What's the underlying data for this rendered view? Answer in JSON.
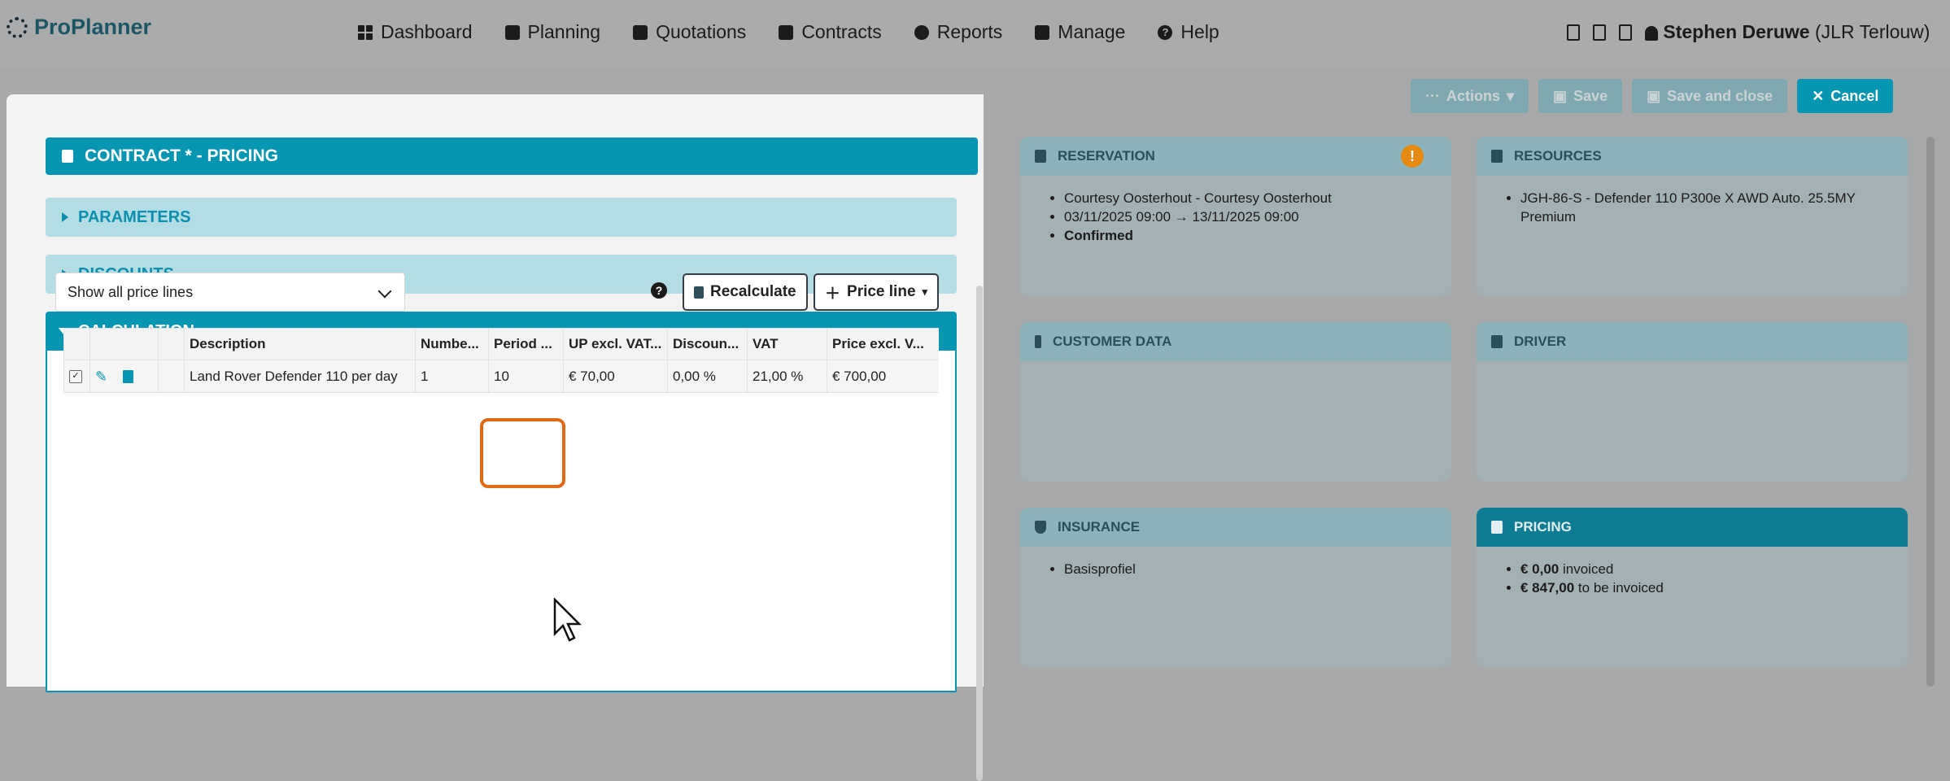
{
  "app": {
    "logo": "ProPlanner"
  },
  "nav": [
    "Dashboard",
    "Planning",
    "Quotations",
    "Contracts",
    "Reports",
    "Manage",
    "Help"
  ],
  "user": {
    "name": "Stephen Deruwe",
    "org": "(JLR Terlouw)"
  },
  "actions": {
    "actions": "Actions",
    "save": "Save",
    "save_close": "Save and close",
    "cancel": "Cancel"
  },
  "modal": {
    "title": "CONTRACT * - PRICING",
    "parameters": "PARAMETERS",
    "discounts": "DISCOUNTS",
    "calculation": "CALCULATION",
    "filter": "Show all price lines",
    "recalculate": "Recalculate",
    "price_line": "Price line",
    "columns": [
      "Description",
      "Numbe...",
      "Period ...",
      "UP excl. VAT...",
      "Discoun...",
      "VAT",
      "Price excl. V..."
    ],
    "rows": [
      {
        "description": "Land Rover Defender 110 per day",
        "number": "1",
        "period": "10",
        "up_excl": "€ 70,00",
        "discount": "0,00 %",
        "vat": "21,00 %",
        "price_excl": "€ 700,00"
      }
    ]
  },
  "cards": {
    "reservation": {
      "title": "RESERVATION",
      "lines": [
        "Courtesy Oosterhout - Courtesy Oosterhout",
        "03/11/2025 09:00 → 13/11/2025 09:00",
        "Confirmed"
      ]
    },
    "resources": {
      "title": "RESOURCES",
      "lines": [
        "JGH-86-S - Defender 110 P300e X AWD Auto. 25.5MY Premium"
      ]
    },
    "customer": {
      "title": "CUSTOMER DATA"
    },
    "driver": {
      "title": "DRIVER"
    },
    "insurance": {
      "title": "INSURANCE",
      "lines": [
        "Basisprofiel"
      ]
    },
    "pricing": {
      "title": "PRICING",
      "invoiced_amount": "€ 0,00",
      "invoiced_label": "invoiced",
      "tobe_amount": "€ 847,00",
      "tobe_label": "to be invoiced"
    }
  }
}
